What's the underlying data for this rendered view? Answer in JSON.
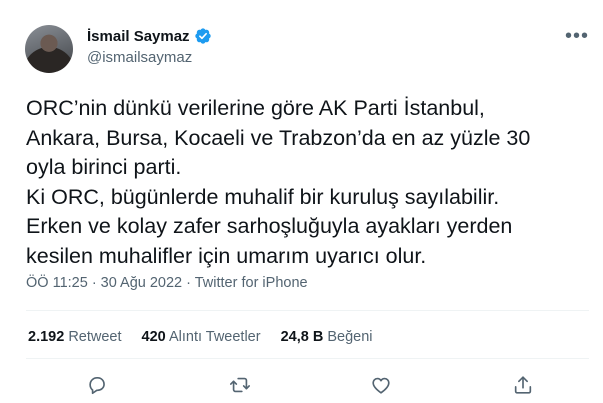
{
  "author": {
    "name": "İsmail Saymaz",
    "handle": "@ismailsaymaz",
    "verified": true
  },
  "tweet": {
    "lines": [
      "ORC’nin dünkü verilerine göre AK Parti İstanbul,",
      "Ankara, Bursa, Kocaeli ve Trabzon’da en az yüzle 30",
      "oyla birinci parti.",
      "Ki ORC, bügünlerde muhalif bir kuruluş sayılabilir.",
      "Erken ve kolay zafer sarhoşluğuyla ayakları yerden",
      "kesilen muhalifler için umarım uyarıcı olur."
    ],
    "meta": "ÖÖ 11:25 · 30 Ağu 2022 · Twitter for iPhone"
  },
  "stats": {
    "retweets": {
      "count": "2.192",
      "label": "Retweet"
    },
    "quotes": {
      "count": "420",
      "label": "Alıntı Tweetler"
    },
    "likes": {
      "count": "24,8 B",
      "label": "Beğeni"
    }
  },
  "icons": {
    "more": "more-icon",
    "reply": "reply-icon",
    "retweet": "retweet-icon",
    "like": "like-icon",
    "share": "share-icon",
    "verified": "verified-badge-icon"
  },
  "colors": {
    "verified": "#1d9bf0",
    "secondary_text": "#536471",
    "primary_text": "#0f1419"
  }
}
